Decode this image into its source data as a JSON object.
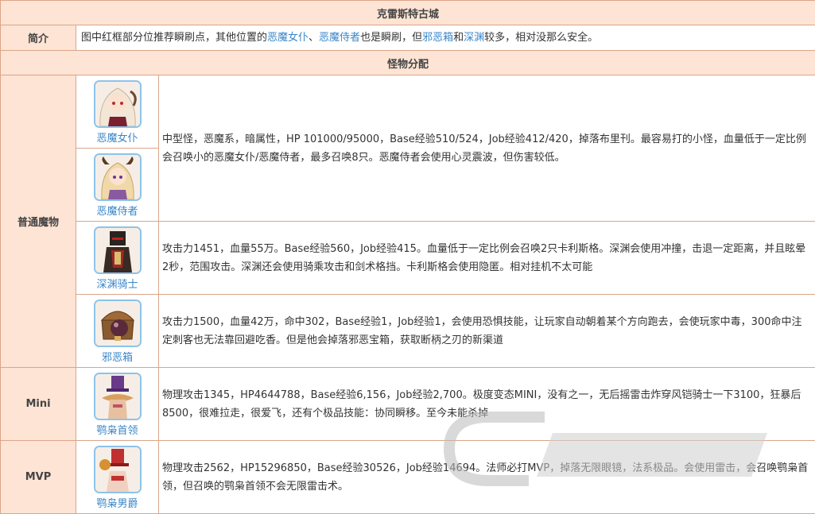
{
  "title": "克雷斯特古城",
  "intro": {
    "label": "简介",
    "t1": "图中红框部分位推荐瞬刷点，其他位置的",
    "l1": "恶魔女仆",
    "sep1": "、",
    "l2": "恶魔侍者",
    "t2": "也是瞬刷，但",
    "l3": "邪恶箱",
    "t3": "和",
    "l4": "深渊",
    "t4": "较多，相对没那么安全。"
  },
  "section_title": "怪物分配",
  "groups": {
    "normal": "普通魔物",
    "mini": "Mini",
    "mvp": "MVP"
  },
  "monsters": [
    {
      "name": "恶魔女仆",
      "icon": "demon-maid-portrait-icon"
    },
    {
      "name": "恶魔侍者",
      "icon": "demon-servant-portrait-icon"
    },
    {
      "name": "深渊骑士",
      "icon": "abyss-knight-portrait-icon"
    },
    {
      "name": "邪恶箱",
      "icon": "evil-chest-portrait-icon"
    },
    {
      "name": "鹗枭首领",
      "icon": "owl-leader-portrait-icon"
    },
    {
      "name": "鹗枭男爵",
      "icon": "owl-baron-portrait-icon"
    }
  ],
  "descriptions": {
    "maid_servant": "中型怪，恶魔系，暗属性，HP 101000/95000，Base经验510/524，Job经验412/420，掉落布里刊。最容易打的小怪，血量低于一定比例会召唤小的恶魔女仆/恶魔侍者，最多召唤8只。恶魔侍者会使用心灵震波，但伤害较低。",
    "knight": "攻击力1451，血量55万。Base经验560，Job经验415。血量低于一定比例会召唤2只卡利斯格。深渊会使用冲撞，击退一定距离，并且眩晕2秒，范围攻击。深渊还会使用骑乘攻击和剑术格挡。卡利斯格会使用隐匿。相对挂机不太可能",
    "chest": "攻击力1500，血量42万，命中302，Base经验1，Job经验1，会使用恐惧技能，让玩家自动朝着某个方向跑去，会使玩家中毒，300命中注定刺客也无法靠回避吃香。但是他会掉落邪恶宝箱，获取断柄之刃的新渠道",
    "owl_leader": "物理攻击1345，HP4644788，Base经验6,156，Job经验2,700。极度变态MINI，没有之一，无后摇雷击炸穿风铠骑士一下3100，狂暴后8500，很难拉走，很爱飞，还有个极品技能：协同瞬移。至今未能杀掉",
    "owl_baron": "物理攻击2562，HP15296850，Base经验30526，Job经验14694。法师必打MVP，掉落无限眼镜，法系极品。会使用雷击，会召唤鹗枭首领，但召唤的鹗枭首领不会无限雷击术。"
  },
  "colors": {
    "header_bg": "#fde4d4",
    "border": "#dba58a",
    "link": "#3a86c8",
    "icon_border": "#8dc3ea"
  }
}
